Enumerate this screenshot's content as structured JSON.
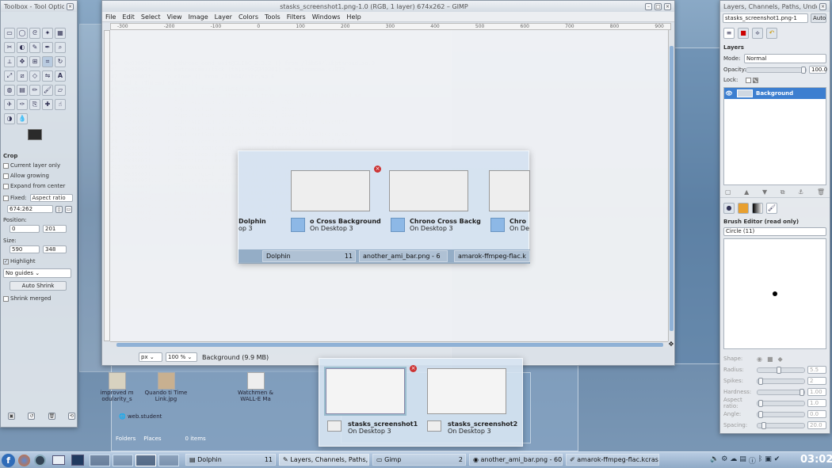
{
  "gimp": {
    "title": "stasks_screenshot1.png-1.0 (RGB, 1 layer) 674x262 – GIMP",
    "menus": [
      "File",
      "Edit",
      "Select",
      "View",
      "Image",
      "Layer",
      "Colors",
      "Tools",
      "Filters",
      "Windows",
      "Help"
    ],
    "ruler_labels": [
      "-300",
      "-200",
      "-100",
      "0",
      "100",
      "200",
      "300",
      "400",
      "500",
      "600",
      "700",
      "800",
      "900"
    ],
    "unit": "px",
    "zoom": "100 %",
    "status": "Background (9.9 MB)"
  },
  "toolbox": {
    "title": "Toolbox - Tool Options",
    "crop_label": "Crop",
    "current_layer_only": "Current layer only",
    "allow_growing": "Allow growing",
    "expand_from_center": "Expand from center",
    "fixed_label": "Fixed:",
    "fixed_value": "Aspect ratio",
    "ratio_value": "674:262",
    "position_label": "Position:",
    "position_unit": "px",
    "pos_x": "0",
    "pos_y": "201",
    "size_label": "Size:",
    "size_unit": "px",
    "size_w": "590",
    "size_h": "348",
    "highlight": "Highlight",
    "guides": "No guides",
    "auto_shrink": "Auto Shrink",
    "shrink_merged": "Shrink merged"
  },
  "layers": {
    "title": "Layers, Channels, Paths, Undo – Brushes, Patte...",
    "image_select": "stasks_screenshot1.png-1",
    "auto_button": "Auto",
    "section_title": "Layers",
    "mode_label": "Mode:",
    "mode_value": "Normal",
    "opacity_label": "Opacity:",
    "opacity_value": "100.0",
    "opacity_level": 1.0,
    "lock_label": "Lock:",
    "layer_name": "Background",
    "brush_editor_title": "Brush Editor (read only)",
    "brush_name": "Circle (11)",
    "brush_params": [
      {
        "label": "Shape:",
        "value": ""
      },
      {
        "label": "Radius:",
        "value": "5.5"
      },
      {
        "label": "Spikes:",
        "value": "2"
      },
      {
        "label": "Hardness:",
        "value": "1.00"
      },
      {
        "label": "Aspect ratio:",
        "value": "1.0"
      },
      {
        "label": "Angle:",
        "value": "0.0"
      },
      {
        "label": "Spacing:",
        "value": "20.0"
      }
    ]
  },
  "popup_top": {
    "items": [
      {
        "title": "Dolphin",
        "sub": "op 3"
      },
      {
        "title": "o Cross Background",
        "sub": "On Desktop 3"
      },
      {
        "title": "Chrono Cross Backg",
        "sub": "On Desktop 3"
      },
      {
        "title": "Chro",
        "sub": "On De"
      }
    ],
    "bar": [
      {
        "label": "Dolphin",
        "badge": "11"
      },
      {
        "label": "another_ami_bar.png - 6"
      },
      {
        "label": "amarok-ffmpeg-flac.k"
      }
    ]
  },
  "popup_bottom": {
    "items": [
      {
        "title": "stasks_screenshot1",
        "sub": "On Desktop 3"
      },
      {
        "title": "stasks_screenshot2",
        "sub": "On Desktop 3"
      }
    ]
  },
  "background_files": [
    "improved m odularity_s",
    "Quando ti Time Link.jpg",
    "Watchmen & WALL-E Ma",
    "web.student"
  ],
  "background_labels": {
    "folders": "Folders",
    "places": "Places",
    "items": "0 items"
  },
  "taskbar": {
    "tasks": [
      {
        "label": "Dolphin",
        "badge": "11"
      },
      {
        "label": "Layers, Channels, Paths,",
        "badge": "3"
      },
      {
        "label": "Gimp",
        "badge": "2"
      },
      {
        "label": "another_ami_bar.png - 60"
      },
      {
        "label": "amarok-ffmpeg-flac.kcras"
      }
    ],
    "clock": "03:02"
  }
}
